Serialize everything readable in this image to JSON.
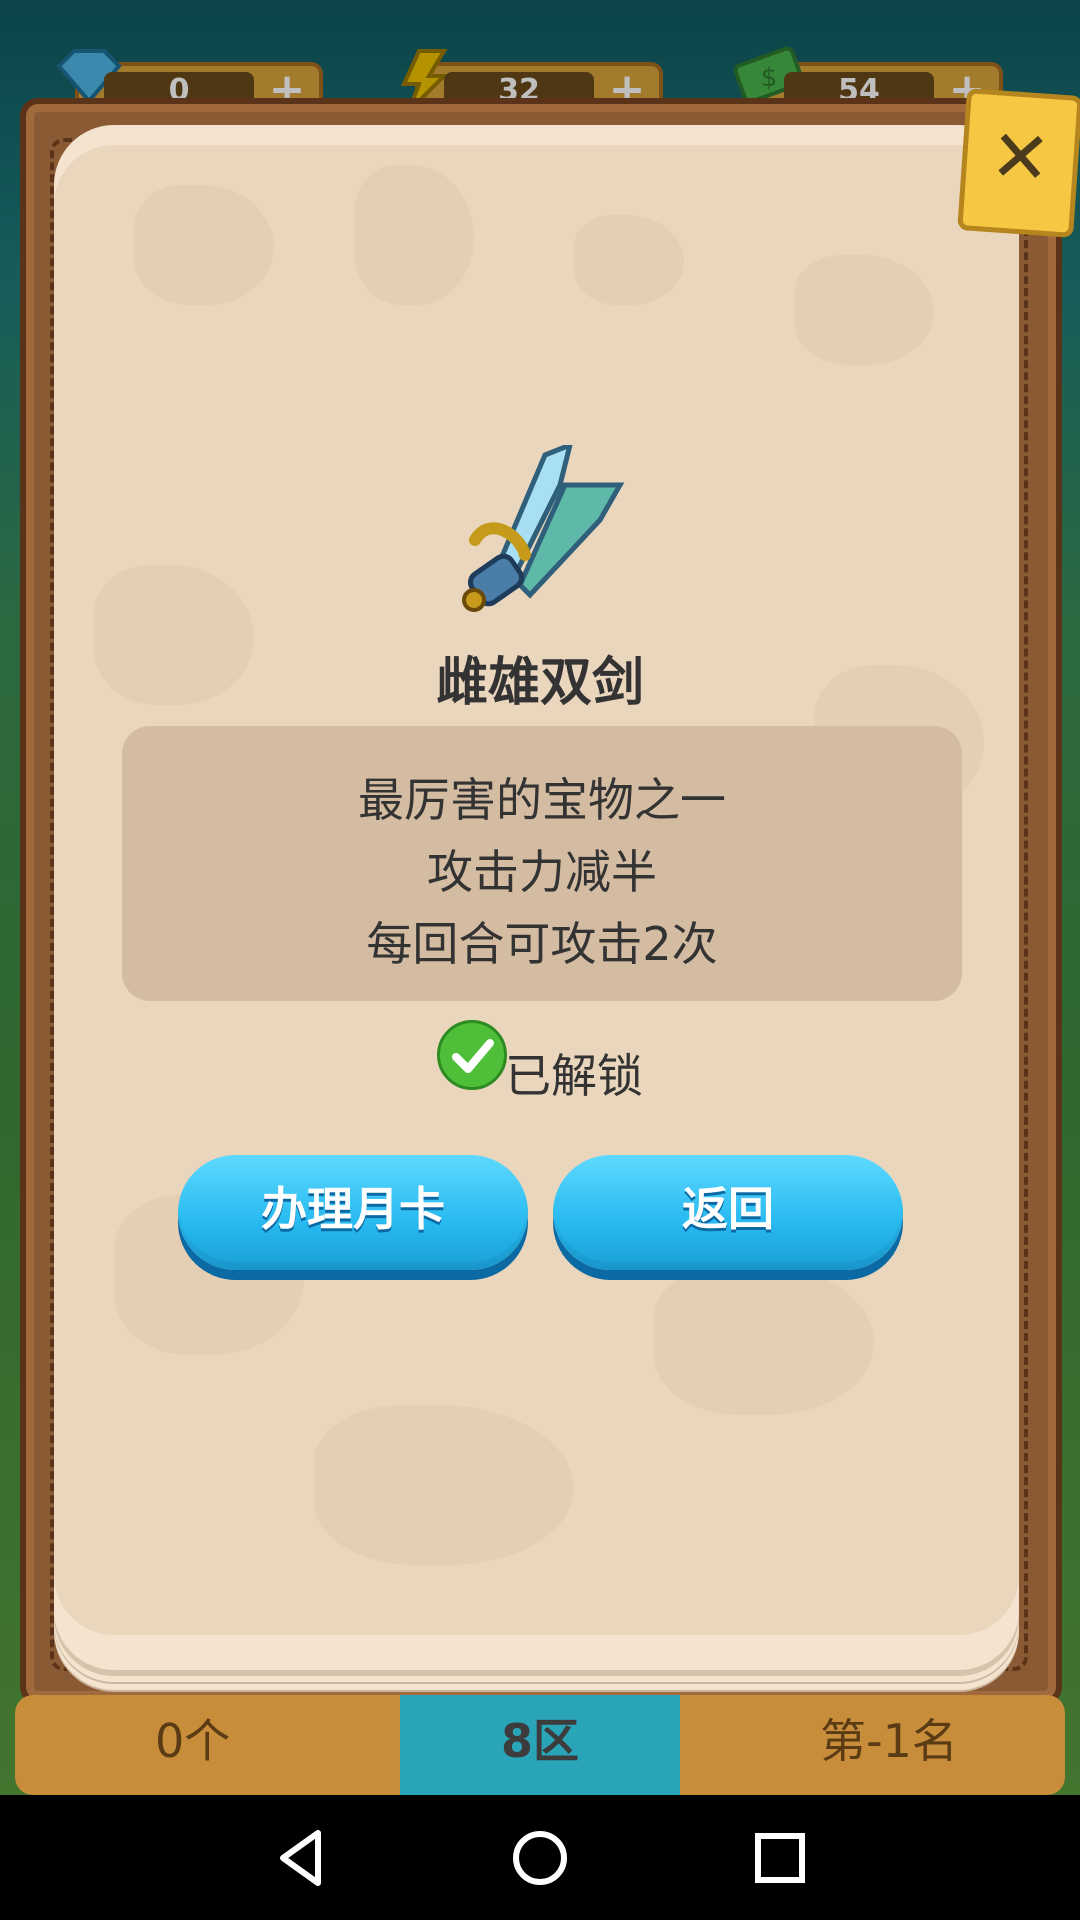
{
  "currency": {
    "gems": "0",
    "energy": "32",
    "cash": "54"
  },
  "modal": {
    "close_icon": "close-icon",
    "item": {
      "icon": "sword-icon",
      "name": "雌雄双剑",
      "description": [
        "最厉害的宝物之一",
        "攻击力减半",
        "每回合可攻击2次"
      ]
    },
    "status": "已解锁",
    "buttons": {
      "monthly_card": "办理月卡",
      "back": "返回"
    }
  },
  "bottom_bar": {
    "count": "0个",
    "zone": "8区",
    "rank": "第-1名"
  },
  "colors": {
    "accent": "#27b9f0",
    "page": "#ead6bd",
    "frame": "#8a5a35"
  }
}
